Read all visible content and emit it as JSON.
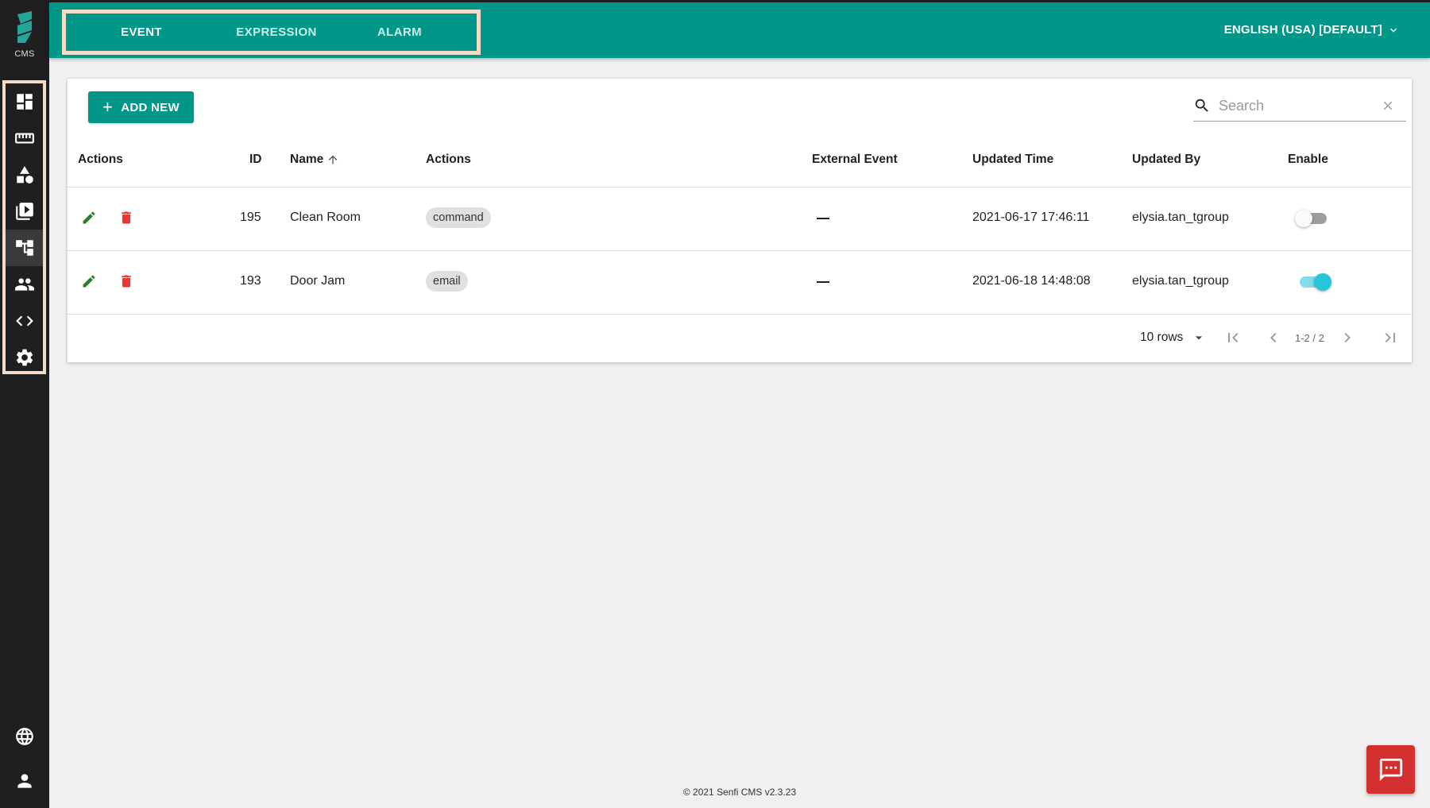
{
  "sidebar": {
    "brand_label": "CMS",
    "nav_items": [
      {
        "icon": "dashboard-icon"
      },
      {
        "icon": "ruler-icon"
      },
      {
        "icon": "shapes-icon"
      },
      {
        "icon": "media-playlist-icon"
      },
      {
        "icon": "hierarchy-icon",
        "active": true
      },
      {
        "icon": "users-icon"
      },
      {
        "icon": "code-icon"
      },
      {
        "icon": "gear-icon"
      }
    ],
    "bottom_items": [
      {
        "icon": "globe-icon"
      },
      {
        "icon": "account-icon"
      }
    ]
  },
  "header": {
    "tabs": [
      {
        "label": "EVENT",
        "active": true
      },
      {
        "label": "EXPRESSION"
      },
      {
        "label": "ALARM"
      }
    ],
    "language": "ENGLISH (USA) [DEFAULT]"
  },
  "toolbar": {
    "add_label": "ADD NEW",
    "search_placeholder": "Search"
  },
  "table": {
    "columns": [
      "Actions",
      "ID",
      "Name",
      "Actions",
      "External Event",
      "Updated Time",
      "Updated By",
      "Enable"
    ],
    "rows": [
      {
        "id": "195",
        "name": "Clean Room",
        "action": "command",
        "external_event": "—",
        "updated_time": "2021-06-17 17:46:11",
        "updated_by": "elysia.tan_tgroup",
        "enabled": false
      },
      {
        "id": "193",
        "name": "Door Jam",
        "action": "email",
        "external_event": "—",
        "updated_time": "2021-06-18 14:48:08",
        "updated_by": "elysia.tan_tgroup",
        "enabled": true
      }
    ]
  },
  "pagination": {
    "rows_per_page": "10 rows",
    "range": "1-2 / 2"
  },
  "footer": {
    "text": "© 2021 Senfi CMS v2.3.23"
  },
  "colors": {
    "primary": "#009688",
    "sidebar": "#1f1f1f",
    "highlight_border": "#f3dcc8",
    "delete": "#e53935",
    "edit": "#2e7d32",
    "toggle_on": "#26c6da",
    "chat": "#d32f2f"
  }
}
